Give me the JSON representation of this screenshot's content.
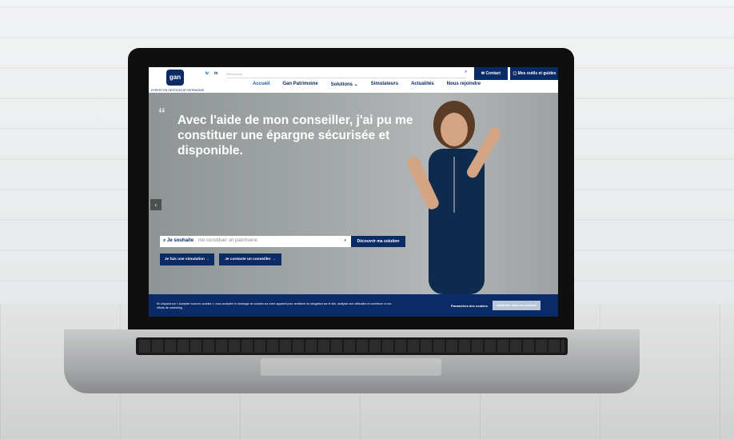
{
  "site": {
    "logo_text": "gan",
    "logo_subtitle": "EXPERT EN GESTION DE PATRIMOINE",
    "search_placeholder": "Rechercher",
    "contact_label": "Contact",
    "tools_label": "Mes outils et guides",
    "social": [
      "twitter",
      "linkedin"
    ]
  },
  "nav": {
    "items": [
      "Accueil",
      "Gan Patrimoine",
      "Solutions ⌄",
      "Simulateurs",
      "Actualités",
      "Nous rejoindre"
    ]
  },
  "hero": {
    "headline": "Avec l'aide de mon conseiller, j'ai pu me constituer une épargne sécurisée et disponible.",
    "search_label": "Je souhaite",
    "search_value": "me constituer un patrimoine",
    "discover_label": "Découvrir ma solution",
    "simulation_label": "Je fais une simulation →",
    "advisor_label": "Je contacte un conseiller →"
  },
  "cookie": {
    "text": "En cliquant sur « Accepter tous les cookies », vous acceptez le stockage de cookies sur votre appareil pour améliorer la navigation sur le site, analyser son utilisation et contribuer à nos efforts de marketing.",
    "settings_label": "Paramètres des cookies",
    "accept_label": "Autoriser tous les cookies"
  },
  "colors": {
    "brand": "#0b2b66",
    "nav_active": "#1a5aa6"
  }
}
